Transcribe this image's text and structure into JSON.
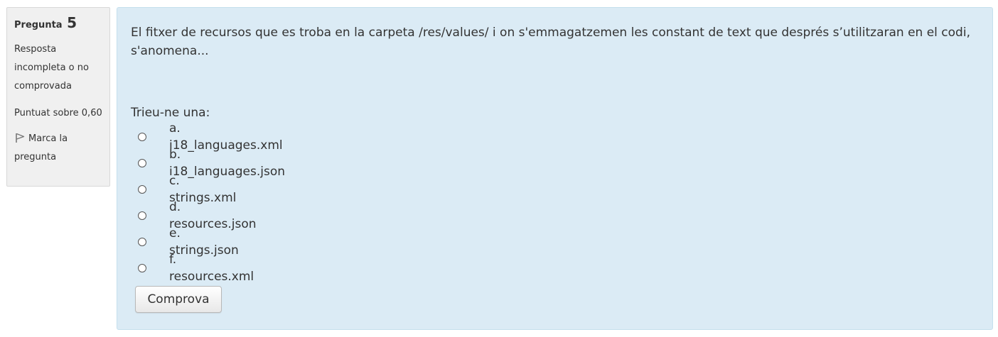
{
  "info": {
    "question_word": "Pregunta",
    "question_number": "5",
    "state": "Resposta incompleta o no comprovada",
    "grade": "Puntuat sobre 0,60",
    "flag_label": "Marca la pregunta",
    "flag_icon": "flag-icon"
  },
  "question": {
    "text": "El fitxer de recursos que es troba en la carpeta /res/values/ i on s'emmagatzemen les constant de text que després s’utilitzaran en el codi, s'anomena...",
    "prompt": "Trieu-ne una:",
    "options": [
      {
        "label": "a. i18_languages.xml",
        "selected": false
      },
      {
        "label": "b. i18_languages.json",
        "selected": false
      },
      {
        "label": "c. strings.xml",
        "selected": false
      },
      {
        "label": "d. resources.json",
        "selected": false
      },
      {
        "label": "e. strings.json",
        "selected": false
      },
      {
        "label": "f. resources.xml",
        "selected": false
      }
    ],
    "check_button": "Comprova"
  },
  "colors": {
    "info_bg": "#f0f0f0",
    "content_bg": "#dbebf5",
    "text": "#333333"
  }
}
